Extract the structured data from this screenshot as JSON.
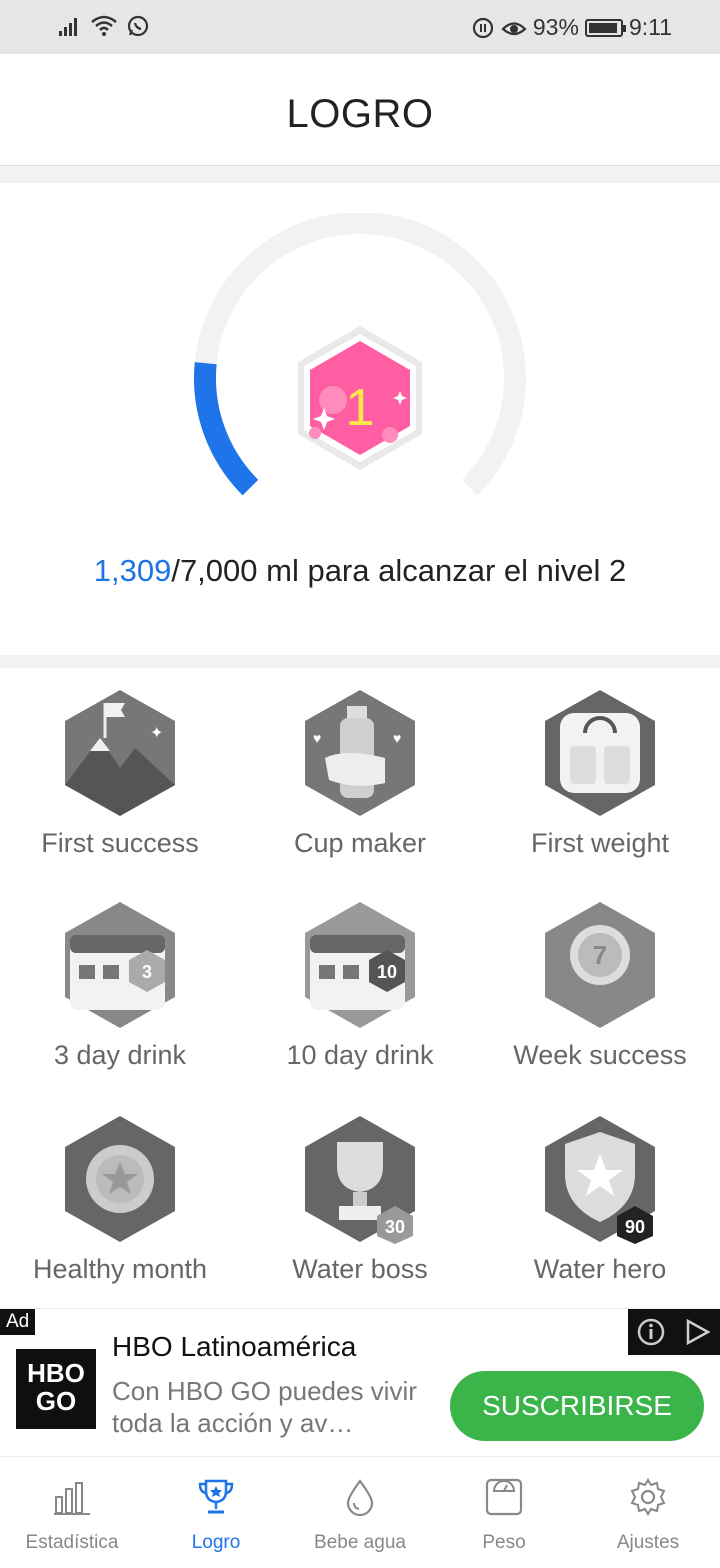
{
  "status_bar": {
    "battery": "93%",
    "battery_level": 0.93,
    "time": "9:11"
  },
  "header": {
    "title": "LOGRO"
  },
  "progress": {
    "level": "1",
    "current": "1,309",
    "rest": "/7,000 ml para alcanzar el nivel 2",
    "current_value": 1309,
    "target_value": 7000
  },
  "achievements": [
    {
      "label": "First success",
      "icon": "mountain-flag-icon"
    },
    {
      "label": "Cup maker",
      "icon": "bottle-hand-icon"
    },
    {
      "label": "First weight",
      "icon": "scale-icon"
    },
    {
      "label": "3 day drink",
      "icon": "calendar-3-icon",
      "badge": "3"
    },
    {
      "label": "10 day drink",
      "icon": "calendar-10-icon",
      "badge": "10"
    },
    {
      "label": "Week success",
      "icon": "medal-7-icon",
      "badge": "7"
    },
    {
      "label": "Healthy month",
      "icon": "star-medal-icon"
    },
    {
      "label": "Water boss",
      "icon": "trophy-icon",
      "badge": "30"
    },
    {
      "label": "Water hero",
      "icon": "shield-star-icon",
      "badge": "90"
    }
  ],
  "ad": {
    "tag": "Ad",
    "logo_line1": "HBO",
    "logo_line2": "GO",
    "title": "HBO Latinoamérica",
    "desc": "Con HBO GO puedes vivir toda la acción y av…",
    "cta": "SUSCRIBIRSE"
  },
  "nav": [
    {
      "label": "Estadística",
      "icon": "bar-chart-icon",
      "active": false
    },
    {
      "label": "Logro",
      "icon": "trophy-icon",
      "active": true
    },
    {
      "label": "Bebe agua",
      "icon": "water-drop-icon",
      "active": false
    },
    {
      "label": "Peso",
      "icon": "scale-icon",
      "active": false
    },
    {
      "label": "Ajustes",
      "icon": "gear-icon",
      "active": false
    }
  ],
  "colors": {
    "accent": "#1e74e8",
    "level_badge": "#ff5fa2",
    "cta": "#3bb44a"
  }
}
